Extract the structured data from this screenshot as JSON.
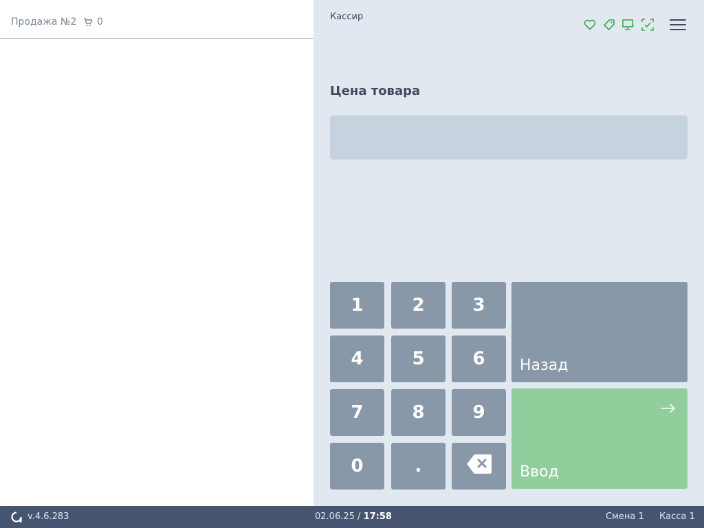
{
  "left_panel": {
    "sale_title": "Продажа №2",
    "cart_count": "0",
    "cart_icon": "cart-icon"
  },
  "header": {
    "role": "Кассир",
    "status_icons": [
      "heart-icon",
      "tag-icon",
      "monitor-icon",
      "scan-check-icon"
    ],
    "status_color": "#2eb24a",
    "menu_icon": "hamburger-menu-icon"
  },
  "price_entry": {
    "label": "Цена товара",
    "value": ""
  },
  "keypad": {
    "digits": [
      "1",
      "2",
      "3",
      "4",
      "5",
      "6",
      "7",
      "8",
      "9",
      "0",
      "."
    ],
    "backspace_icon": "backspace-icon",
    "back_label": "Назад",
    "enter_label": "Ввод",
    "enter_icon": "arrow-right-icon",
    "enter_color": "#90cf9c",
    "key_color": "#8898a8"
  },
  "footer": {
    "version": "v.4.6.283",
    "date": "02.06.25",
    "separator": "/",
    "time": "17:58",
    "shift": "Смена 1",
    "till": "Касса 1",
    "logo_icon": "app-logo-icon"
  }
}
